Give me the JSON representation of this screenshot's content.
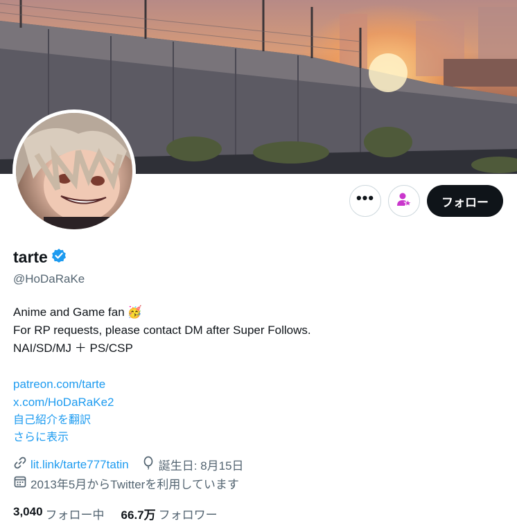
{
  "profile": {
    "display_name": "tarte",
    "handle": "@HoDaRaKe",
    "verified_icon": "verified-badge-icon",
    "bio_lines": [
      "Anime and Game fan",
      "For RP requests, please contact DM after Super Follows.",
      "NAI/SD/MJ ＋ PS/CSP"
    ],
    "bio_emoji": "🥳",
    "bio_links": [
      "patreon.com/tarte",
      "x.com/HoDaRaKe2"
    ],
    "translate_label": "自己紹介を翻訳",
    "show_more_label": "さらに表示",
    "website": "lit.link/tarte777tatin",
    "birthday": "誕生日: 8月15日",
    "joined": "2013年5月からTwitterを利用しています"
  },
  "actions": {
    "more_label": "•••",
    "follow_label": "フォロー"
  },
  "stats": {
    "following_count": "3,040",
    "following_label": "フォロー中",
    "followers_count": "66.7万",
    "followers_label": "フォロワー"
  },
  "colors": {
    "accent": "#1d9bf0",
    "follow_button": "#0f1419",
    "super_follow": "#c936cc",
    "secondary_text": "#536471"
  }
}
